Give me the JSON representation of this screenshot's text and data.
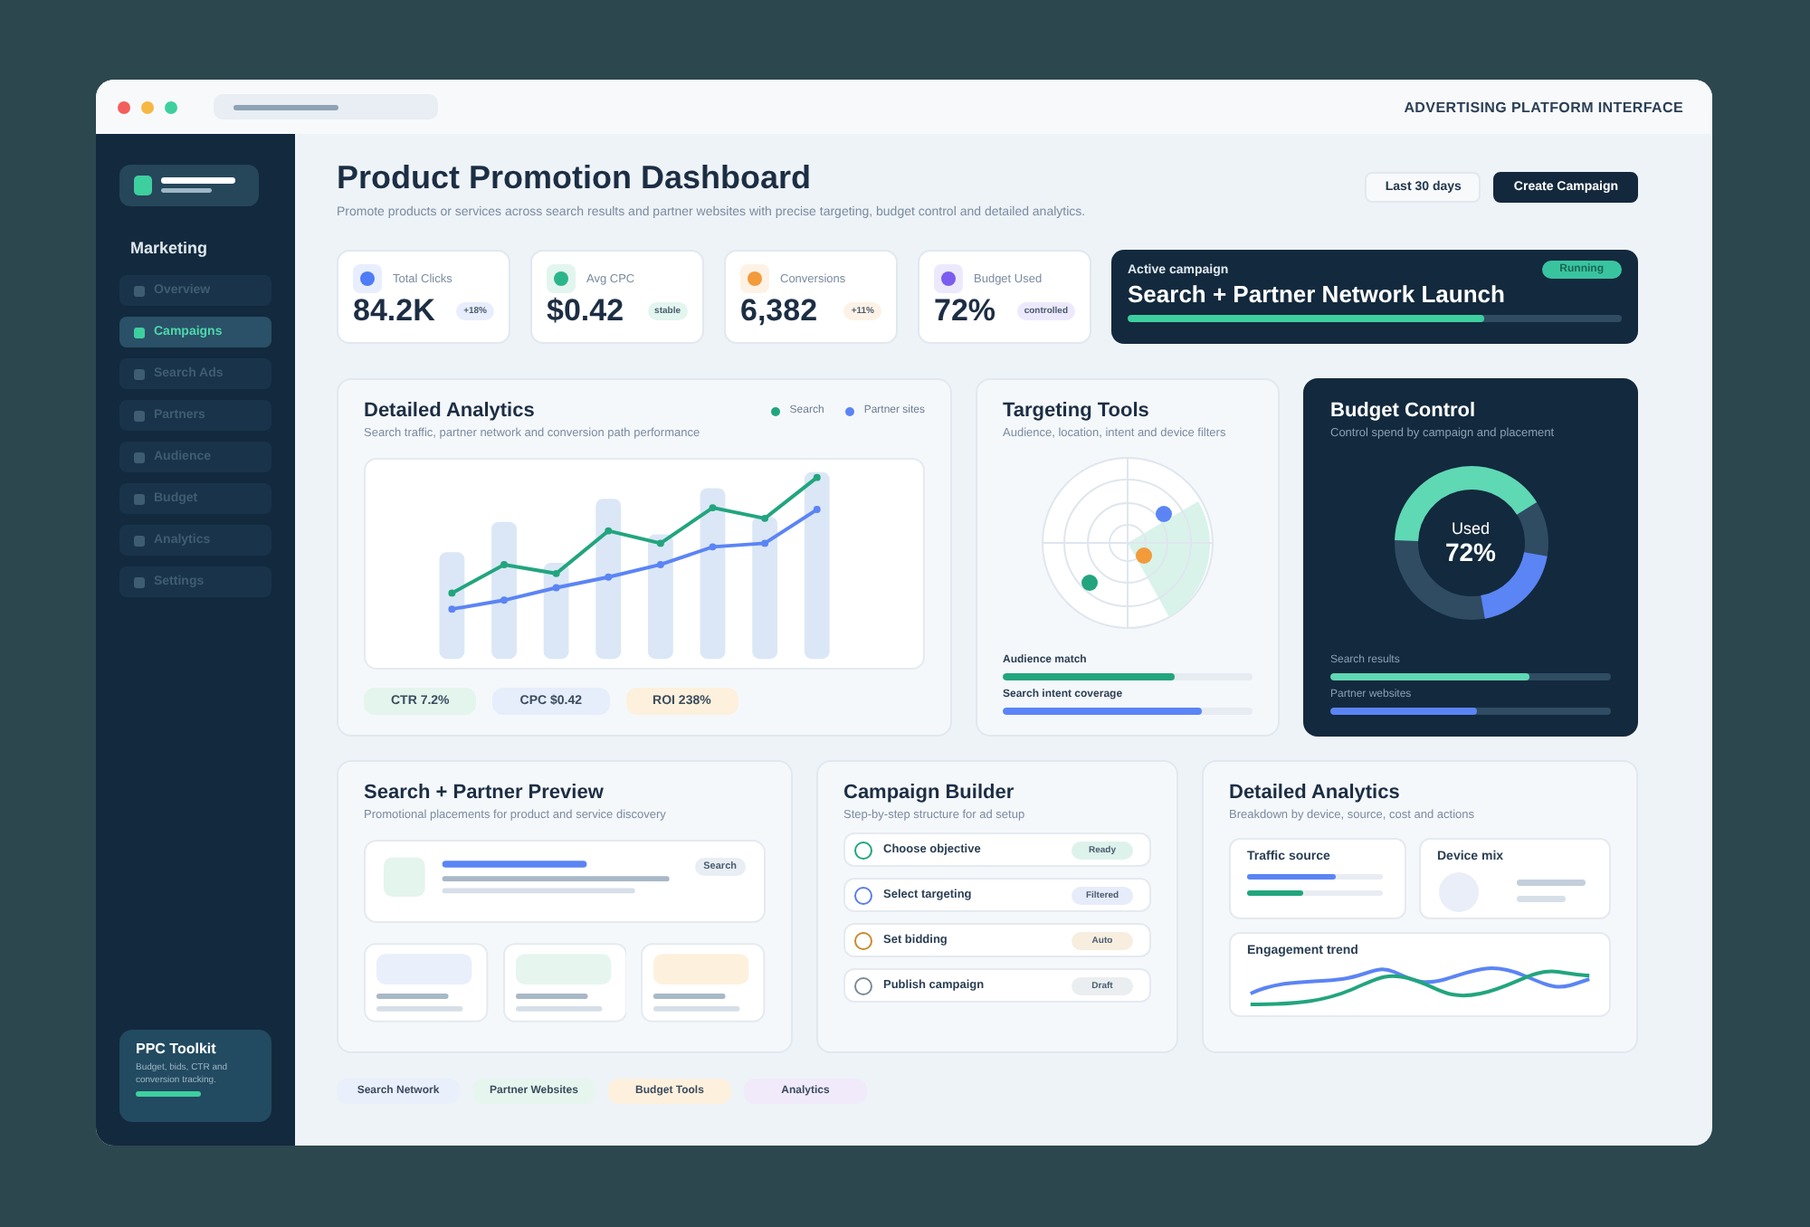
{
  "window": {
    "title": "ADVERTISING PLATFORM INTERFACE"
  },
  "sidebar": {
    "section": "Marketing",
    "items": [
      {
        "label": "Overview",
        "selected": false
      },
      {
        "label": "Campaigns",
        "selected": true
      },
      {
        "label": "Search Ads",
        "selected": false
      },
      {
        "label": "Partners",
        "selected": false
      },
      {
        "label": "Audience",
        "selected": false
      },
      {
        "label": "Budget",
        "selected": false
      },
      {
        "label": "Analytics",
        "selected": false
      },
      {
        "label": "Settings",
        "selected": false
      }
    ],
    "promo": {
      "title": "PPC Toolkit",
      "text": "Budget, bids, CTR and conversion tracking."
    }
  },
  "header": {
    "title": "Product Promotion Dashboard",
    "subtitle": "Promote products or services across search results and partner websites with precise targeting, budget control and detailed analytics.",
    "buttons": [
      {
        "label": "Last 30 days",
        "kind": "secondary"
      },
      {
        "label": "Create Campaign",
        "kind": "primary"
      }
    ]
  },
  "stats": [
    {
      "label": "Total Clicks",
      "value": "84.2K",
      "badge": "+18%",
      "color": "#4f7cf7"
    },
    {
      "label": "Avg CPC",
      "value": "$0.42",
      "badge": "stable",
      "color": "#2bb58a"
    },
    {
      "label": "Conversions",
      "value": "6,382",
      "badge": "+11%",
      "color": "#f39a3b"
    },
    {
      "label": "Budget Used",
      "value": "72%",
      "badge": "controlled",
      "color": "#7b5cf0"
    }
  ],
  "active_campaign": {
    "label": "Active campaign",
    "status": "Running",
    "title": "Search + Partner Network Launch",
    "level": 0.72
  },
  "analytics": {
    "title": "Detailed Analytics",
    "subtitle": "Search traffic, partner network and conversion path performance",
    "legend": [
      {
        "label": "Search",
        "color": "#22a57e"
      },
      {
        "label": "Partner sites",
        "color": "#5b84f5"
      }
    ],
    "pills": [
      {
        "label": "CTR 7.2%",
        "color": "#e3f5ec"
      },
      {
        "label": "CPC $0.42",
        "color": "#e6edfb"
      },
      {
        "label": "ROI 238%",
        "color": "#fdf0dc"
      }
    ]
  },
  "targeting": {
    "title": "Targeting Tools",
    "subtitle": "Audience, location, intent and device filters",
    "meters": [
      {
        "label": "Audience match",
        "level": 0.69,
        "color": "#22a57e"
      },
      {
        "label": "Search intent coverage",
        "level": 0.8,
        "color": "#5b84f5"
      }
    ]
  },
  "budget": {
    "title": "Budget Control",
    "subtitle": "Control spend by campaign and placement",
    "center_label": "Used",
    "center_value": "72%",
    "meters": [
      {
        "label": "Search results",
        "level": 0.71,
        "color": "#5fd8b4"
      },
      {
        "label": "Partner websites",
        "level": 0.52,
        "color": "#5b84f5"
      }
    ]
  },
  "preview": {
    "title": "Search + Partner Preview",
    "subtitle": "Promotional placements for product and service discovery",
    "tag": "Search"
  },
  "builder": {
    "title": "Campaign Builder",
    "subtitle": "Step-by-step structure for ad setup",
    "steps": [
      {
        "label": "Choose objective",
        "status": "Ready",
        "color": "#22a57e"
      },
      {
        "label": "Select targeting",
        "status": "Filtered",
        "color": "#5b7ee6"
      },
      {
        "label": "Set bidding",
        "status": "Auto",
        "color": "#c98a2b"
      },
      {
        "label": "Publish campaign",
        "status": "Draft",
        "color": "#7c8a99"
      }
    ]
  },
  "breakdown": {
    "title": "Detailed Analytics",
    "subtitle": "Breakdown by device, source, cost and actions",
    "tiles": [
      {
        "title": "Traffic source",
        "kind": "bars"
      },
      {
        "title": "Device mix",
        "kind": "mix"
      },
      {
        "title": "Engagement trend",
        "kind": "trend"
      }
    ]
  },
  "chips": [
    {
      "label": "Search Network",
      "color": "#e9effb"
    },
    {
      "label": "Partner Websites",
      "color": "#e6f6ee"
    },
    {
      "label": "Budget Tools",
      "color": "#fdf1de"
    },
    {
      "label": "Analytics",
      "color": "#f0eafb"
    }
  ]
}
